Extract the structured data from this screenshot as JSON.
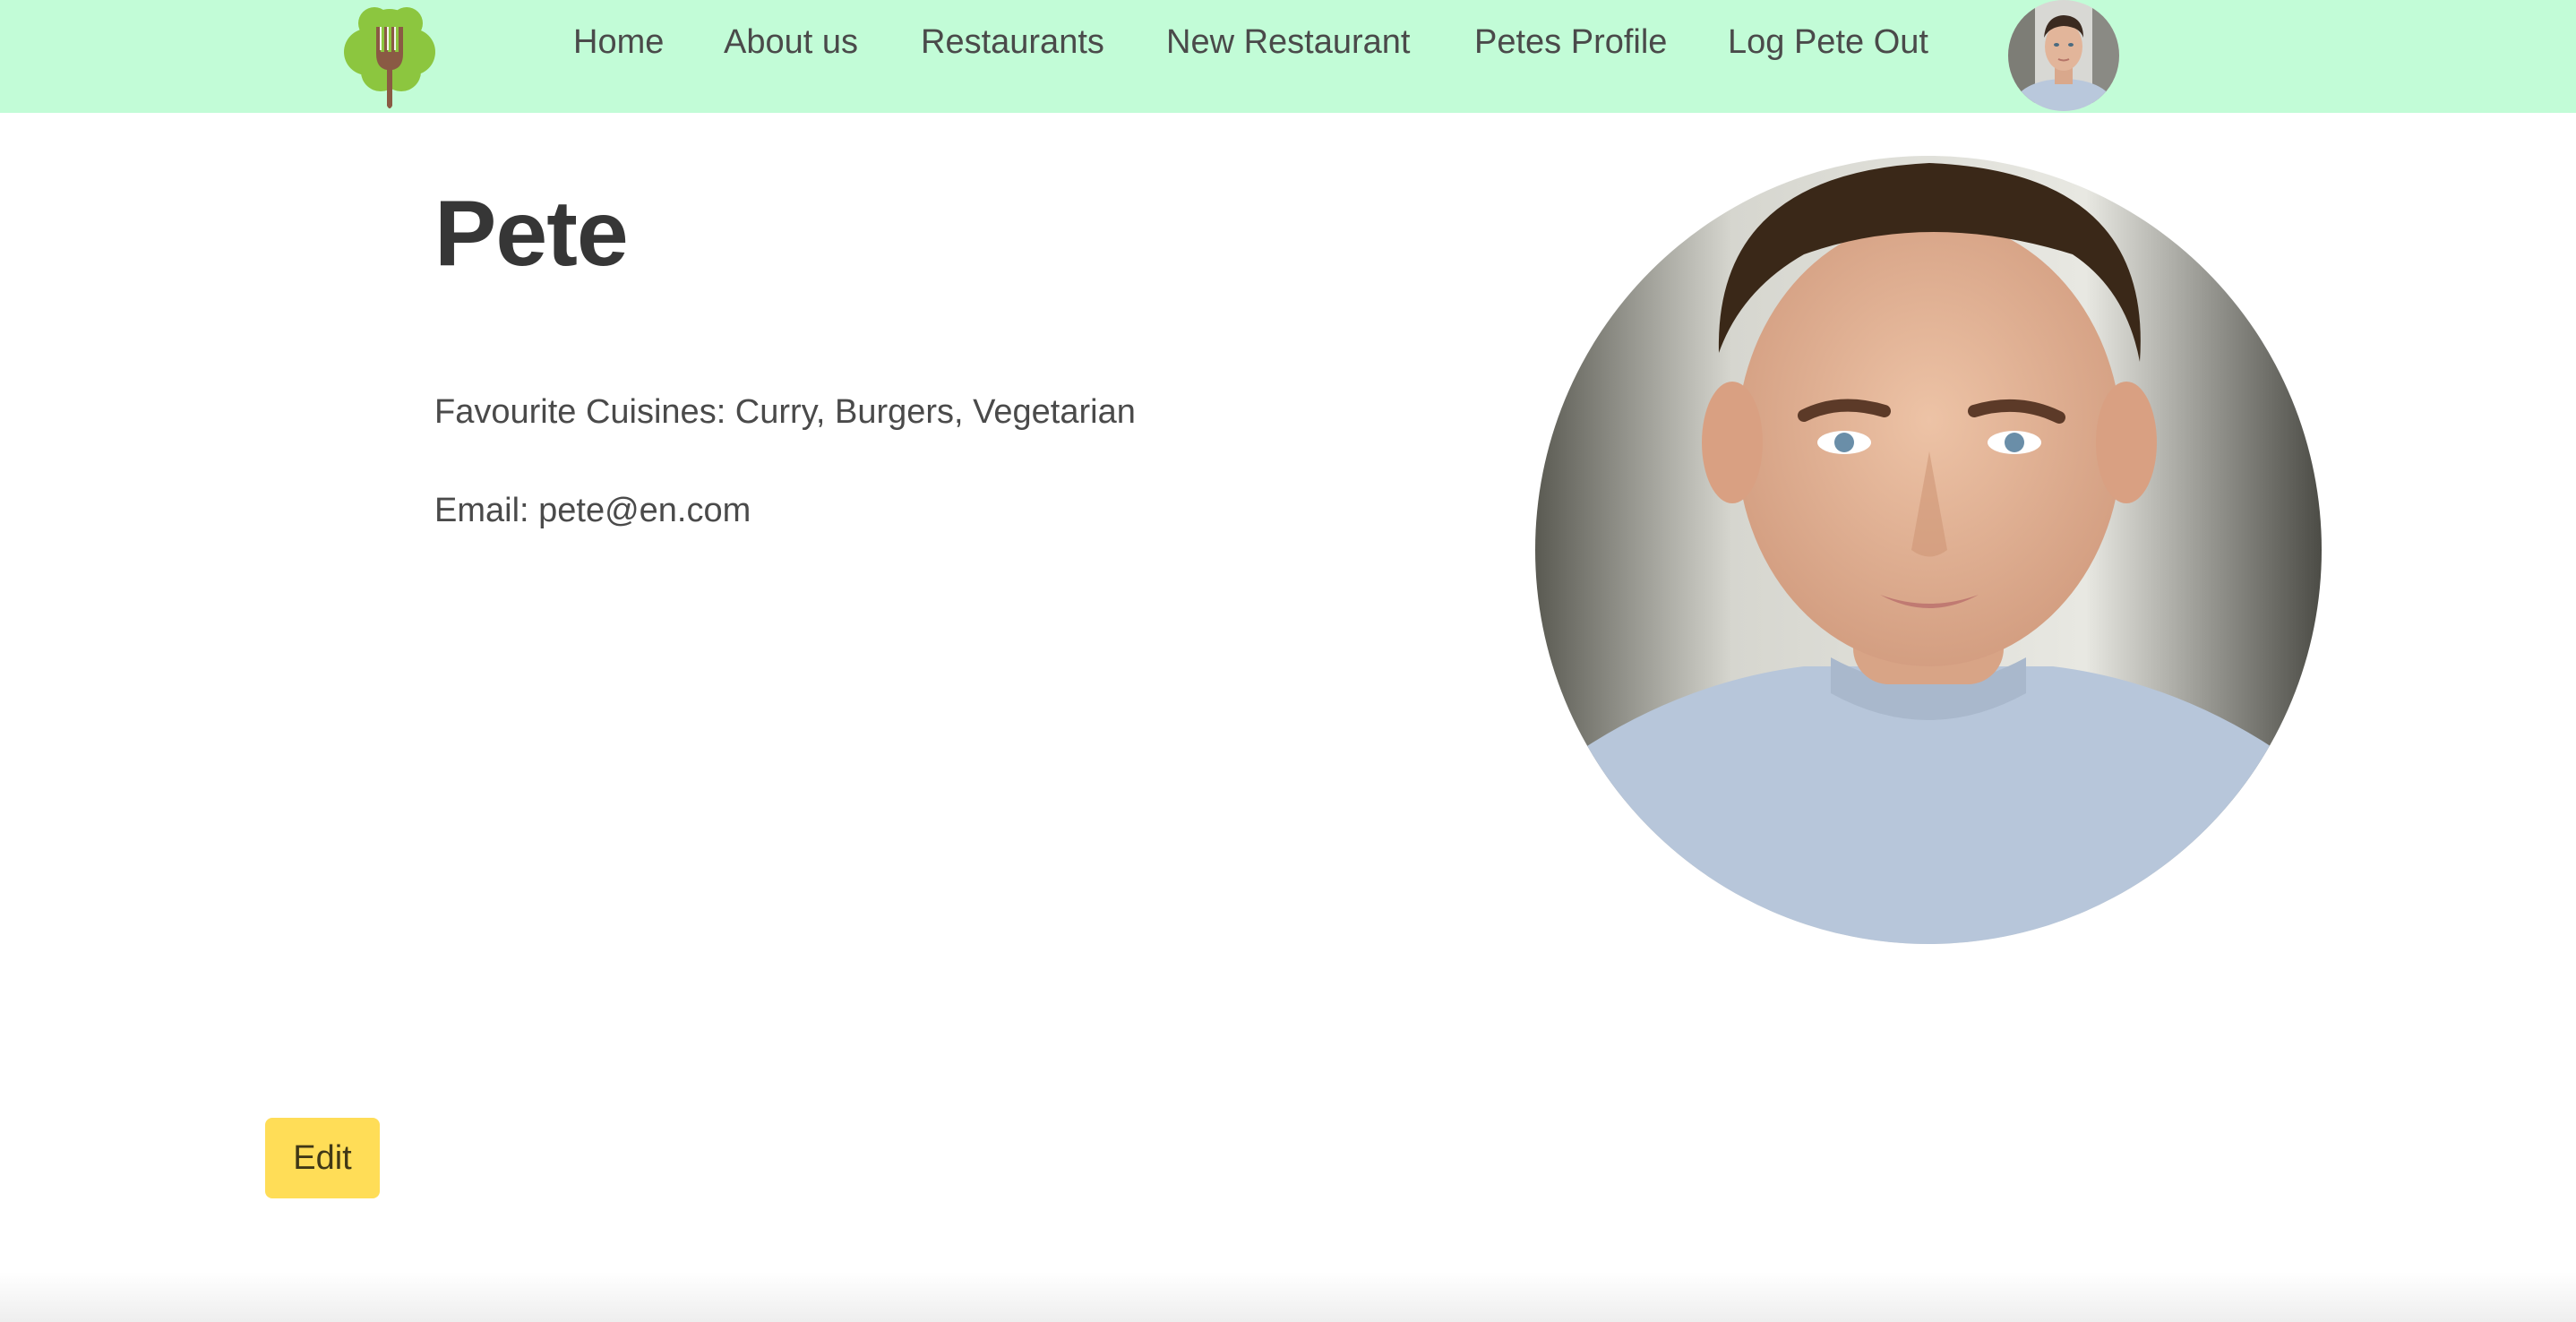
{
  "nav": {
    "items": [
      {
        "label": "Home"
      },
      {
        "label": "About us"
      },
      {
        "label": "Restaurants"
      },
      {
        "label": "New Restaurant"
      },
      {
        "label": "Petes Profile"
      },
      {
        "label": "Log Pete Out"
      }
    ]
  },
  "profile": {
    "name": "Pete",
    "cuisines": "Favourite Cuisines: Curry, Burgers, Vegetarian",
    "email": "Email: pete@en.com"
  },
  "actions": {
    "edit_label": "Edit"
  },
  "colors": {
    "navbar": "#c2fcd7",
    "logo_green": "#8cc63f",
    "logo_fork": "#8a5a44",
    "edit_button": "#ffdd57"
  },
  "icons": {
    "logo": "tree-fork-icon"
  }
}
